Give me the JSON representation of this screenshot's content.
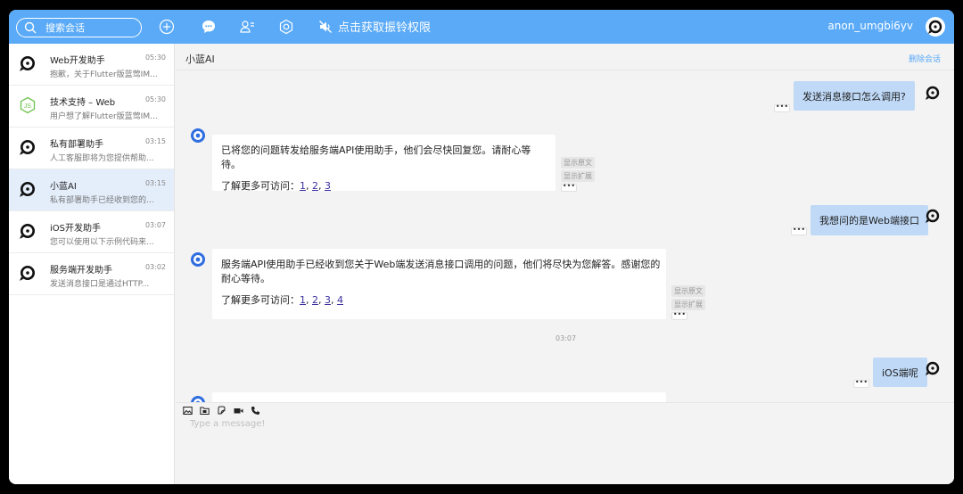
{
  "topbar": {
    "search_placeholder": "搜索会话",
    "mute_label": "点击获取振铃权限",
    "username": "anon_umgbi6yv",
    "colors": {
      "bar": "#5aaaf7"
    }
  },
  "conversations": [
    {
      "name": "Web开发助手",
      "time": "05:30",
      "preview": "抱歉，关于Flutter版蓝莺IM...",
      "avatar": "ring-avatar-icon"
    },
    {
      "name": "技术支持 – Web",
      "time": "05:30",
      "preview": "用户想了解Flutter版蓝莺IM...",
      "avatar": "nodejs-icon"
    },
    {
      "name": "私有部署助手",
      "time": "03:15",
      "preview": "人工客服即将为您提供帮助...",
      "avatar": "ring-avatar-icon"
    },
    {
      "name": "小蓝AI",
      "time": "03:15",
      "preview": "私有部署助手已经收到您的...",
      "avatar": "ring-avatar-icon"
    },
    {
      "name": "iOS开发助手",
      "time": "03:07",
      "preview": "您可以使用以下示例代码来...",
      "avatar": "ring-avatar-icon"
    },
    {
      "name": "服务端开发助手",
      "time": "03:02",
      "preview": "发送消息接口是通过HTTP...",
      "avatar": "ring-avatar-icon"
    }
  ],
  "chat": {
    "title": "小蓝AI",
    "delete_label": "删除会话",
    "messages": [
      {
        "dir": "out",
        "text": "发送消息接口怎么调用?"
      },
      {
        "dir": "in",
        "text": "已将您的问题转发给服务端API使用助手，他们会尽快回复您。请耐心等待。",
        "learn_more": "了解更多可访问：",
        "links": [
          "1",
          "2",
          "3"
        ],
        "tags": [
          "显示原文",
          "显示扩展"
        ]
      },
      {
        "dir": "out",
        "text": "我想问的是Web端接口"
      },
      {
        "dir": "in",
        "text_line1": "服务端API使用助手已经收到您关于Web端发送消息接口调用的问题，他们将尽快为您解答。感谢您的",
        "text_line2": "耐心等待。",
        "learn_more": "了解更多可访问：",
        "links": [
          "1",
          "2",
          "3",
          "4"
        ],
        "tags": [
          "显示原文",
          "显示扩展"
        ]
      },
      {
        "dir": "out",
        "text": "iOS端呢"
      }
    ],
    "timestamp": "03:07",
    "more_label": "•••"
  },
  "input": {
    "placeholder": "Type a message!",
    "tools": [
      "image-icon",
      "folder-icon",
      "sticker-icon",
      "video-call-icon",
      "phone-icon"
    ]
  }
}
